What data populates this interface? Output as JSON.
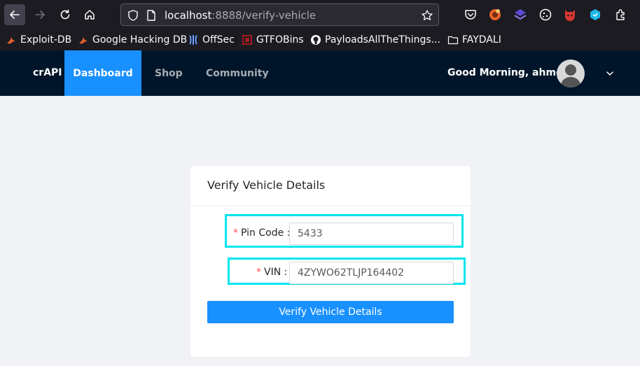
{
  "browser": {
    "url_host": "localhost",
    "url_rest": ":8888/verify-vehicle",
    "toolbar_bg": "#1c1b22"
  },
  "bookmarks": [
    {
      "label": "Exploit-DB",
      "icon": "exploitdb-icon"
    },
    {
      "label": "Google Hacking DB",
      "icon": "ghdb-icon"
    },
    {
      "label": "OffSec",
      "icon": "offsec-icon"
    },
    {
      "label": "GTFOBins",
      "icon": "gtfobins-icon"
    },
    {
      "label": "PayloadsAllTheThings...",
      "icon": "github-icon"
    },
    {
      "label": "FAYDALI",
      "icon": "folder-icon"
    }
  ],
  "nav": {
    "brand": "crAPI",
    "items": [
      {
        "label": "Dashboard",
        "active": true
      },
      {
        "label": "Shop",
        "active": false
      },
      {
        "label": "Community",
        "active": false
      }
    ],
    "greeting": "Good Morning, ahmet!",
    "bg": "#001529",
    "accent": "#1890ff"
  },
  "form": {
    "title": "Verify Vehicle Details",
    "required_mark": "*",
    "pin_label": "Pin Code",
    "pin_value": "5433",
    "vin_label": "VIN",
    "vin_value": "4ZYWO62TLJP164402",
    "label_suffix": ":",
    "submit_label": "Verify Vehicle Details",
    "highlight_color": "#00e5ee"
  }
}
